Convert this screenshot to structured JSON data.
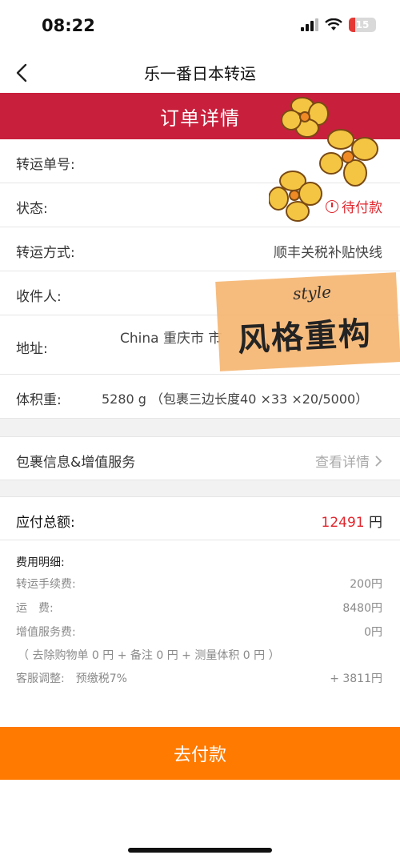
{
  "status_bar": {
    "time": "08:22",
    "battery": "15"
  },
  "nav": {
    "title": "乐一番日本转运"
  },
  "banner": {
    "title": "订单详情"
  },
  "details": {
    "tracking_label": "转运单号:",
    "status_label": "状态:",
    "status_value": "待付款",
    "method_label": "转运方式:",
    "method_value": "顺丰关税补贴快线",
    "recipient_label": "收件人:",
    "address_label": "地址:",
    "address_value": "China 重庆市 市",
    "weight_label": "体积重:",
    "weight_value": "5280 g （包裹三边长度40 ×33 ×20/5000）"
  },
  "package": {
    "label": "包裹信息&增值服务",
    "link": "查看详情"
  },
  "total": {
    "label": "应付总额:",
    "amount": "12491",
    "unit": "円"
  },
  "fees": {
    "title": "费用明细:",
    "items": [
      {
        "label": "转运手续费:",
        "value": "200円"
      },
      {
        "label": "运　费:",
        "value": "8480円"
      },
      {
        "label": "增值服务费:",
        "value": "0円"
      }
    ],
    "note": "（ 去除购物单 0 円 + 备注 0 円 + 测量体积 0 円 ）",
    "adjust_label": "客服调整:　预缴税7%",
    "adjust_value": "+ 3811円"
  },
  "pay_button": "去付款",
  "sticker": {
    "small": "style",
    "big": "风格重构"
  },
  "colors": {
    "banner": "#c8203c",
    "accent_red": "#e0262d",
    "pay_button": "#ff7a00",
    "sticker": "#f6b774"
  }
}
